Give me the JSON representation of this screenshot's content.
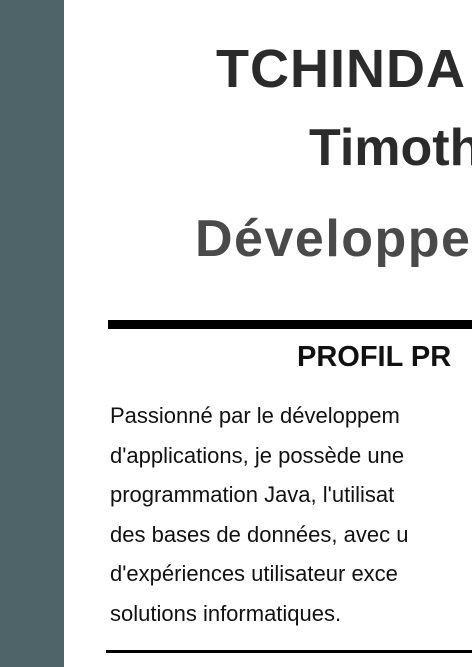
{
  "header": {
    "surname": "TCHINDA",
    "first_name": "Timoth",
    "role": "Développe"
  },
  "profile": {
    "title": "PROFIL PR",
    "lines": [
      "Passionné par le développem",
      "d'applications, je possède une",
      "programmation Java, l'utilisat",
      "des bases de données, avec u",
      "d'expériences utilisateur exce",
      "solutions informatiques."
    ]
  },
  "colors": {
    "sidebar": "#4e6468",
    "rule": "#000000"
  }
}
